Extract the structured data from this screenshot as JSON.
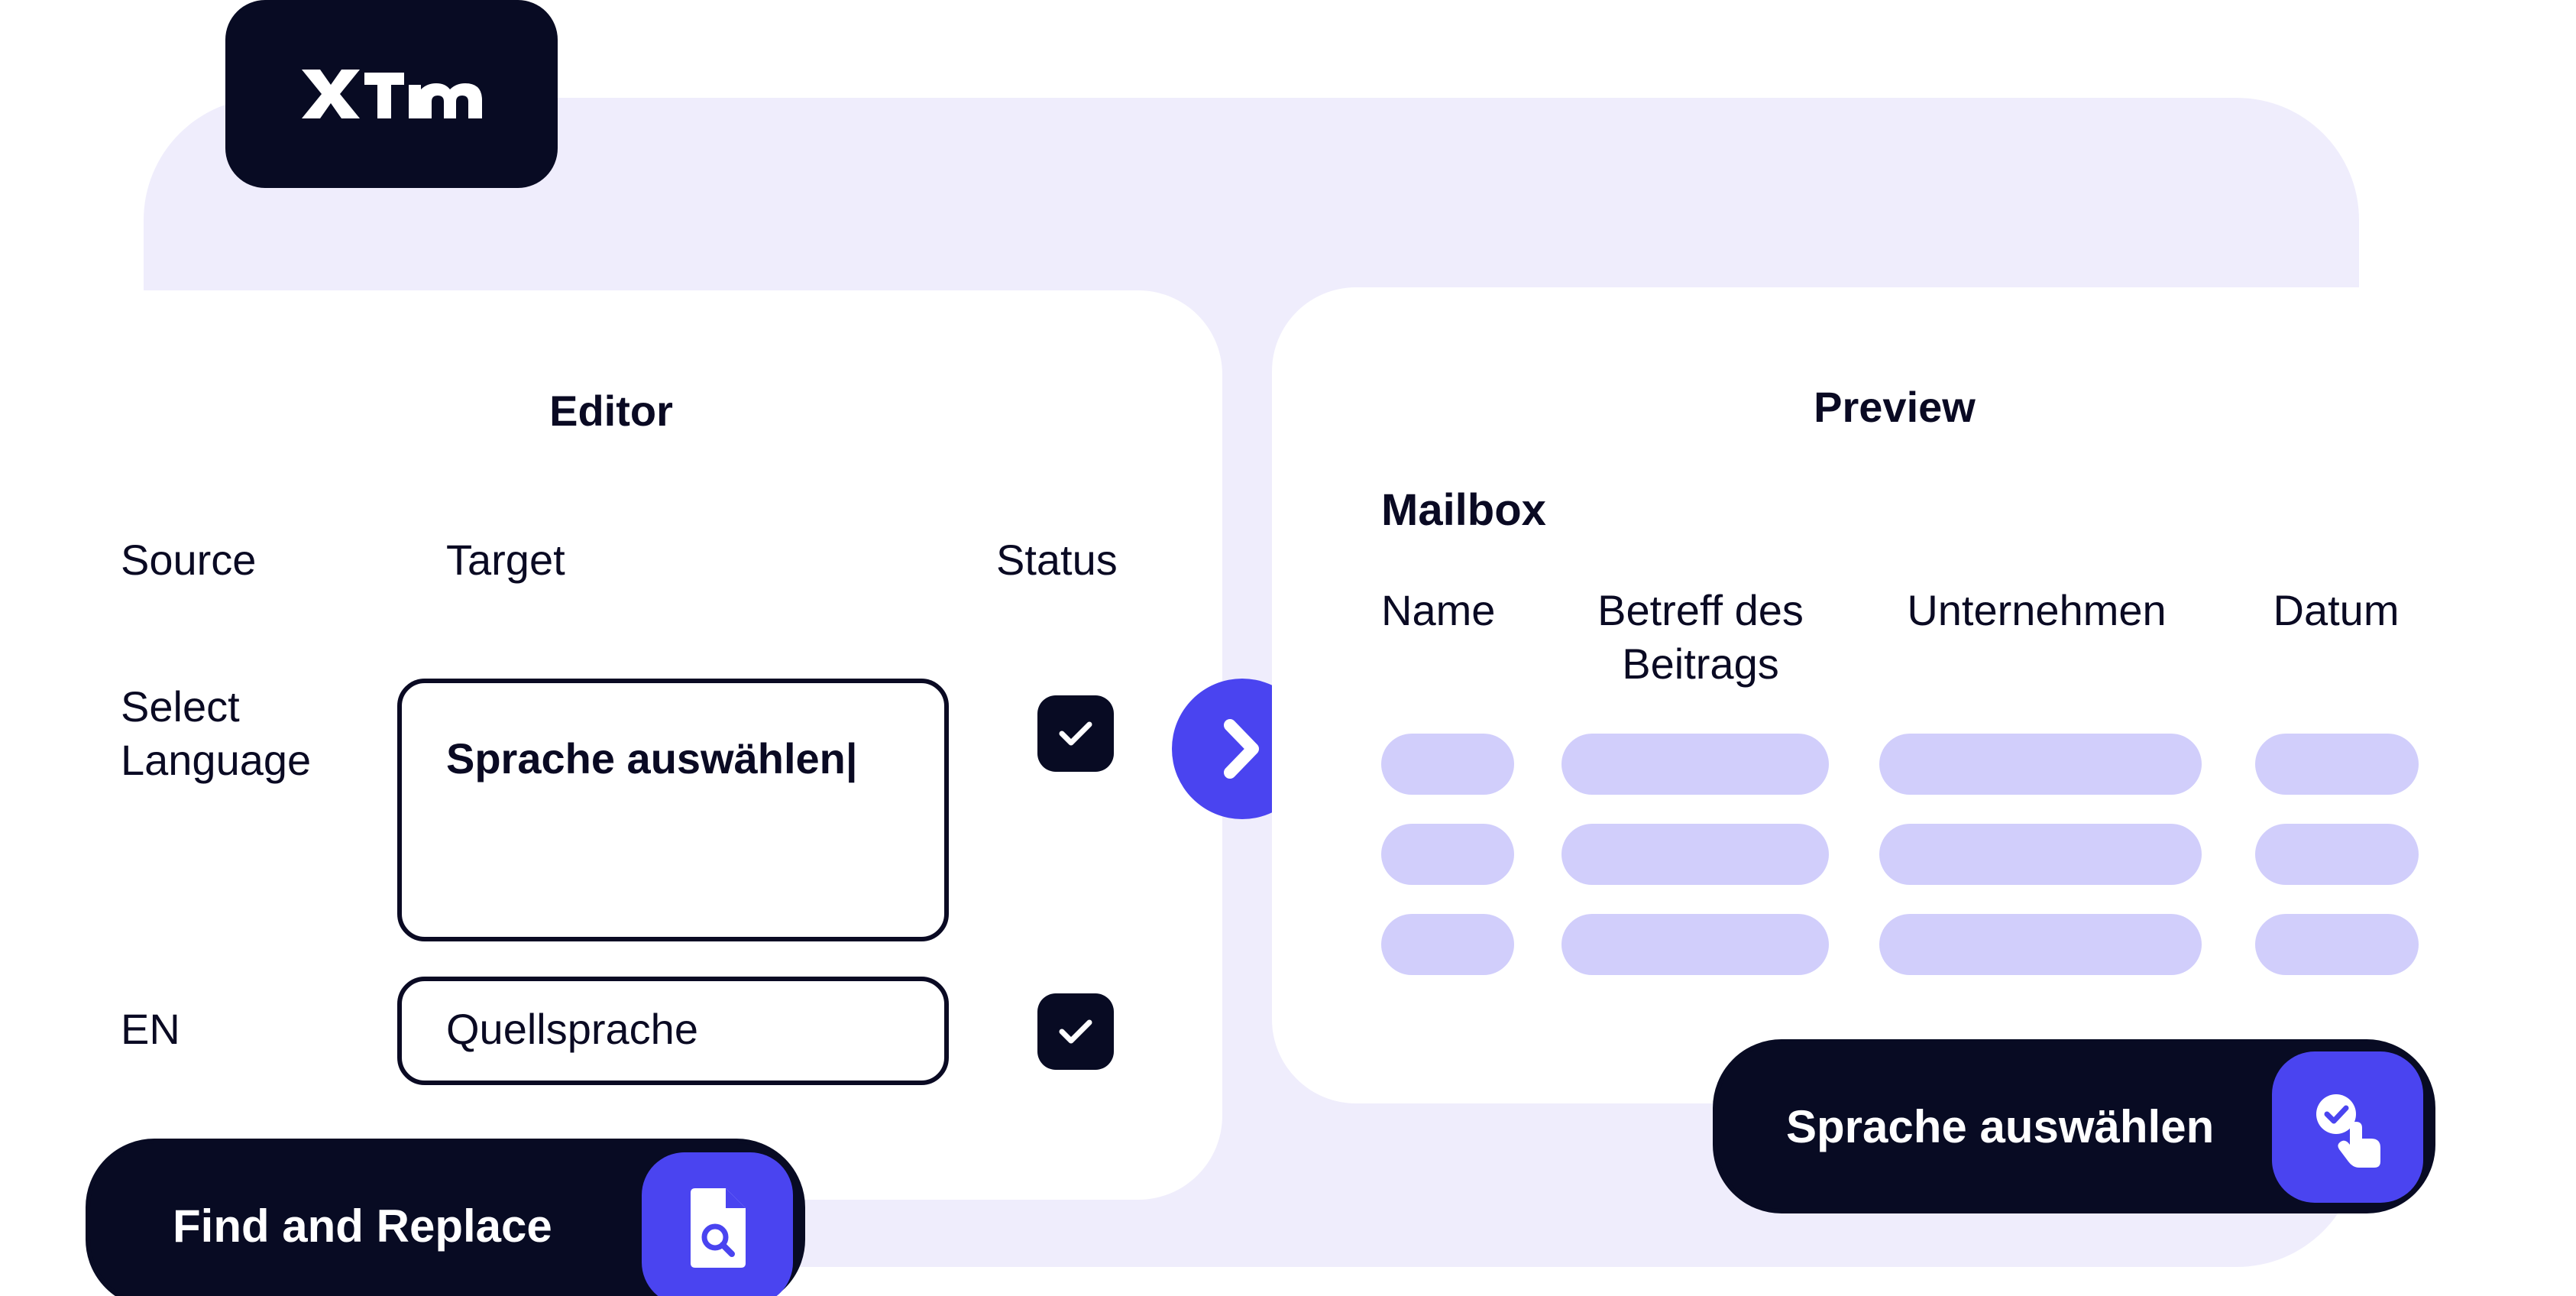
{
  "logo": {
    "text": "XTM"
  },
  "editor": {
    "title": "Editor",
    "columns": {
      "source": "Source",
      "target": "Target",
      "status": "Status"
    },
    "rows": [
      {
        "source": "Select Language",
        "target": "Sprache auswählen|",
        "status": "checked"
      },
      {
        "source": "EN",
        "target": "Quellsprache",
        "status": "checked"
      }
    ]
  },
  "preview": {
    "title": "Preview",
    "mailbox_label": "Mailbox",
    "columns": [
      "Name",
      "Betreff des Beitrags",
      "Unternehmen",
      "Datum"
    ],
    "placeholder_rows": 3
  },
  "actions": {
    "find_replace": {
      "label": "Find and Replace",
      "icon": "document-search-icon"
    },
    "select_language": {
      "label": "Sprache auswählen",
      "icon": "tap-check-icon"
    }
  },
  "colors": {
    "dark": "#080b23",
    "accent": "#4a44f0",
    "frame": "#efedfc",
    "placeholder": "#d1cefb"
  }
}
